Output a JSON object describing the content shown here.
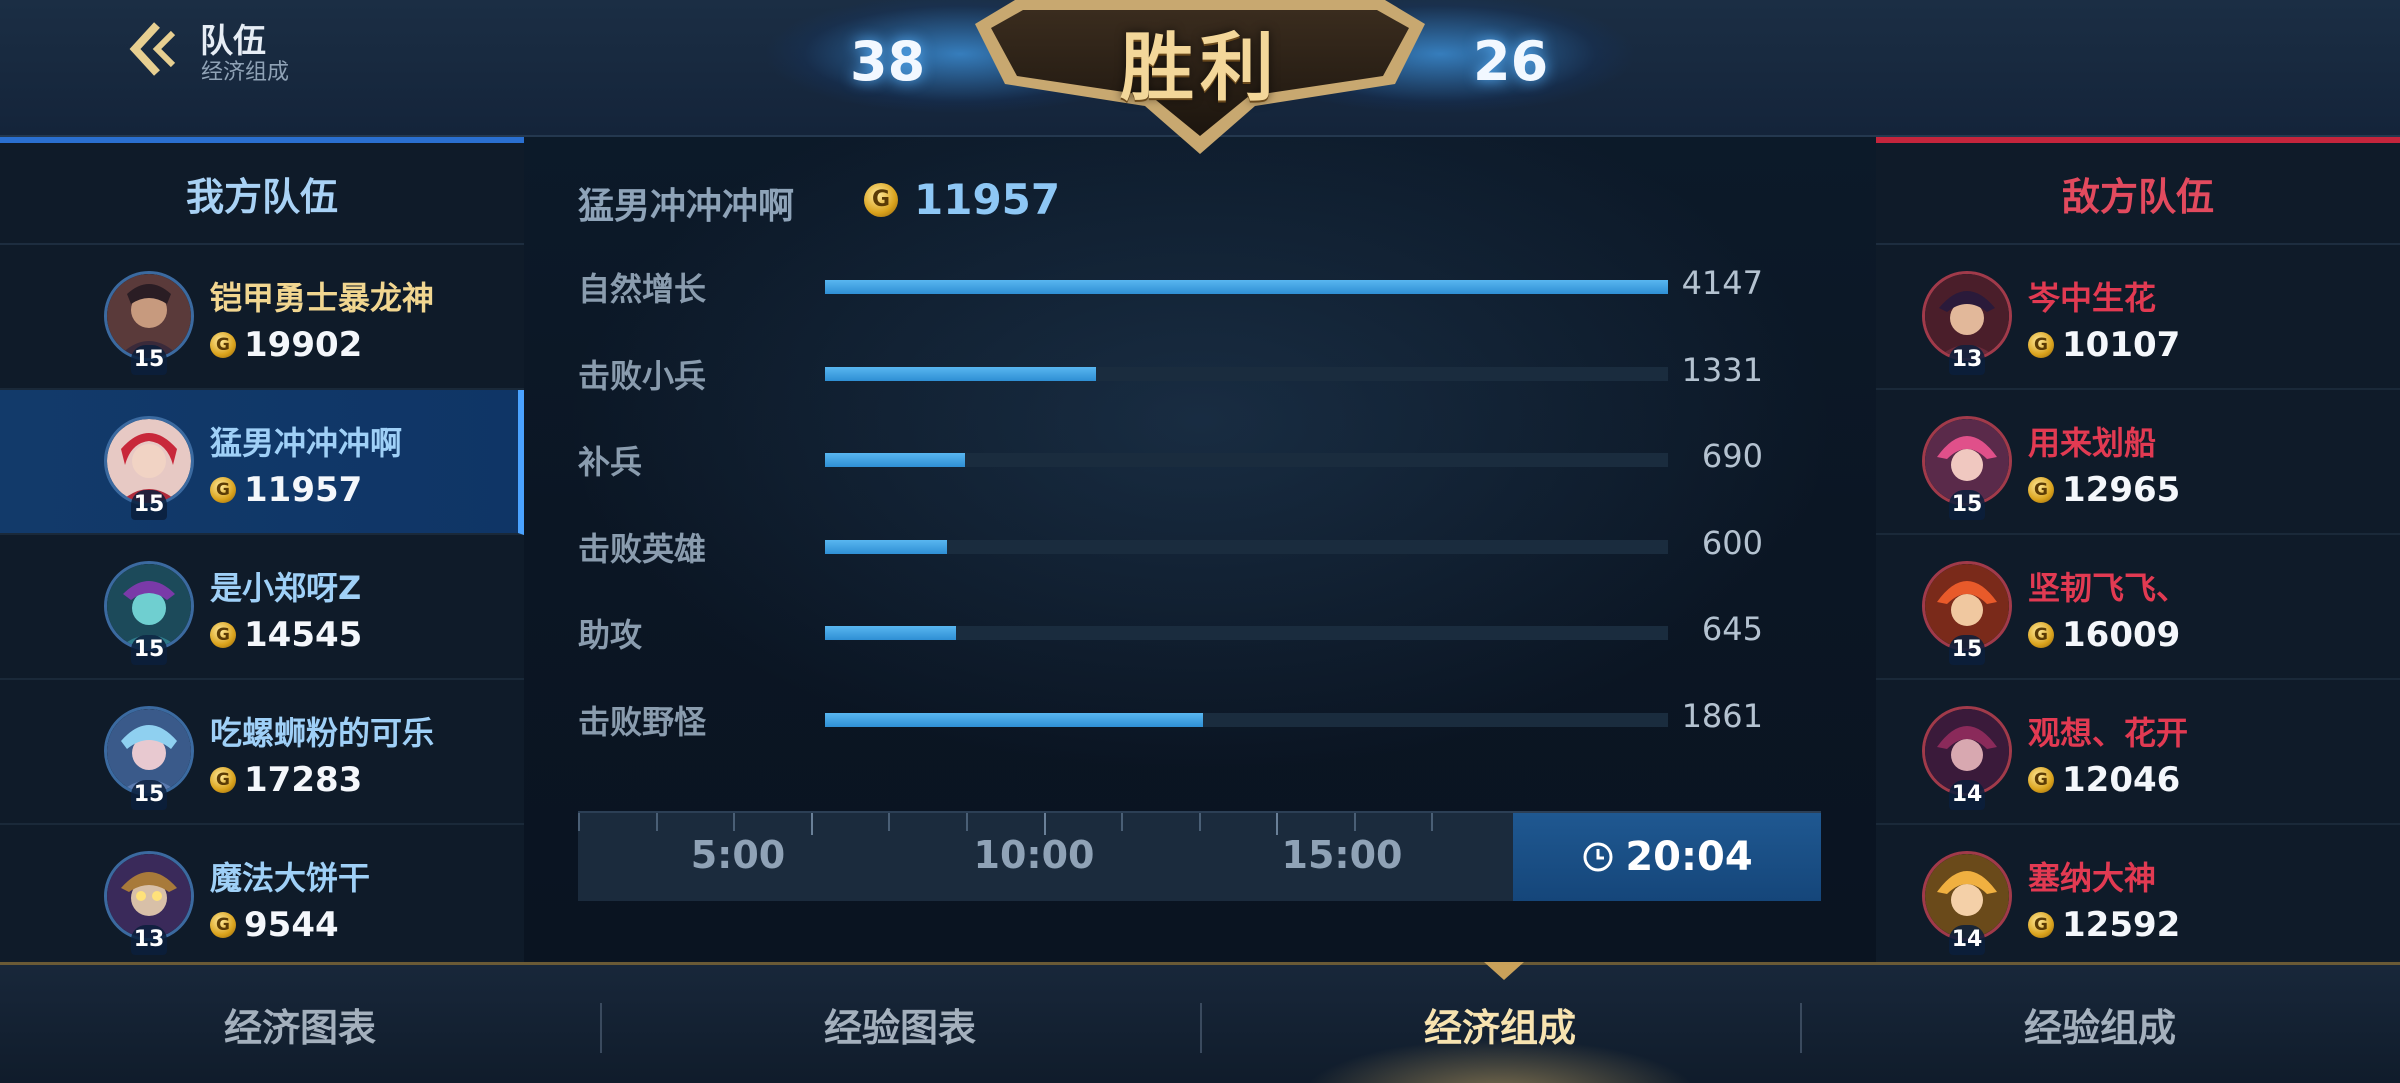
{
  "header": {
    "title": "队伍",
    "subtitle": "经济组成",
    "result": "胜利",
    "score_left": "38",
    "score_right": "26"
  },
  "left_team": {
    "title": "我方队伍",
    "players": [
      {
        "name": "铠甲勇士暴龙神",
        "gold": "19902",
        "level": "15"
      },
      {
        "name": "猛男冲冲冲啊",
        "gold": "11957",
        "level": "15"
      },
      {
        "name": "是小郑呀Z",
        "gold": "14545",
        "level": "15"
      },
      {
        "name": "吃螺蛳粉的可乐",
        "gold": "17283",
        "level": "15"
      },
      {
        "name": "魔法大饼干",
        "gold": "9544",
        "level": "13"
      }
    ]
  },
  "right_team": {
    "title": "敌方队伍",
    "players": [
      {
        "name": "岑中生花",
        "gold": "10107",
        "level": "13"
      },
      {
        "name": "用来划船",
        "gold": "12965",
        "level": "15"
      },
      {
        "name": "坚韧飞飞、",
        "gold": "16009",
        "level": "15"
      },
      {
        "name": "观想、花开",
        "gold": "12046",
        "level": "14"
      },
      {
        "name": "塞纳大神",
        "gold": "12592",
        "level": "14"
      }
    ]
  },
  "detail": {
    "player_name": "猛男冲冲冲啊",
    "total_gold": "11957",
    "coin_symbol": "G"
  },
  "chart_data": {
    "type": "bar",
    "categories": [
      "自然增长",
      "击败小兵",
      "补兵",
      "击败英雄",
      "助攻",
      "击败野怪"
    ],
    "values": [
      4147,
      1331,
      690,
      600,
      645,
      1861
    ],
    "xlim": [
      0,
      4147
    ]
  },
  "timeline": {
    "labels": [
      "5:00",
      "10:00",
      "15:00"
    ],
    "current": "20:04"
  },
  "tabs": [
    "经济图表",
    "经验图表",
    "经济组成",
    "经验组成"
  ],
  "active_tab": 2,
  "side_id": "134898973",
  "colors": {
    "ally": "#9fd0f7",
    "enemy": "#e23a52",
    "bar": "#3ea3e4",
    "gold": "#d9a21c"
  }
}
